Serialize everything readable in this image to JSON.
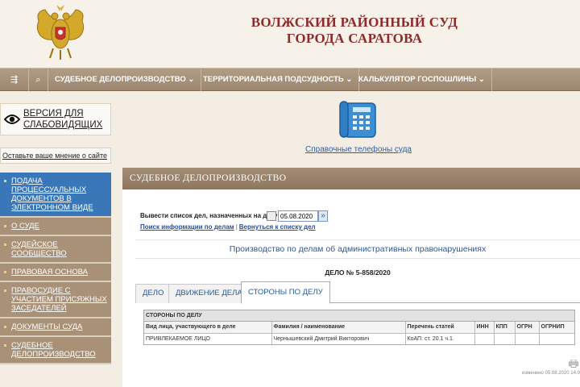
{
  "header": {
    "title_line1": "ВОЛЖСКИЙ РАЙОННЫЙ СУД",
    "title_line2": "ГОРОДА САРАТОВА"
  },
  "nav": {
    "items": [
      {
        "label": "СУДЕБНОЕ ДЕЛОПРОИЗВОДСТВО ⌄"
      },
      {
        "label": "ТЕРРИТОРИАЛЬНАЯ ПОДСУДНОСТЬ ⌄"
      },
      {
        "label": "КАЛЬКУЛЯТОР ГОСПОШЛИНЫ ⌄"
      }
    ],
    "icons": [
      "sitemap-icon",
      "search-icon"
    ]
  },
  "sidebar": {
    "a11y_label": "ВЕРСИЯ ДЛЯ СЛАБОВИДЯЩИХ",
    "feedback_label": "Оставьте ваше мнение о сайте",
    "items": [
      {
        "label": "ПОДАЧА ПРОЦЕССУАЛЬНЫХ ДОКУМЕНТОВ В ЭЛЕКТРОННОМ ВИДЕ",
        "active": true
      },
      {
        "label": "О СУДЕ"
      },
      {
        "label": "СУДЕЙСКОЕ СООБЩЕСТВО"
      },
      {
        "label": "ПРАВОВАЯ ОСНОВА"
      },
      {
        "label": "ПРАВОСУДИЕ С УЧАСТИЕМ ПРИСЯЖНЫХ ЗАСЕДАТЕЛЕЙ"
      },
      {
        "label": "ДОКУМЕНТЫ СУДА"
      },
      {
        "label": "СУДЕБНОЕ ДЕЛОПРОИЗВОДСТВО"
      }
    ]
  },
  "main": {
    "phone_link": "Справочные телефоны суда",
    "section_title": "СУДЕБНОЕ ДЕЛОПРОИЗВОДСТВО",
    "date_label": "Вывести список дел, назначенных на дату",
    "date_value": "05.08.2020",
    "search_link": "Поиск информации по делам",
    "back_link": "Вернуться к списку дел",
    "production_title": "Производство по делам об административных правонарушениях",
    "case_number": "ДЕЛО № 5-858/2020",
    "tabs": [
      {
        "label": "ДЕЛО"
      },
      {
        "label": "ДВИЖЕНИЕ ДЕЛА"
      },
      {
        "label": "СТОРОНЫ ПО ДЕЛУ",
        "active": true
      }
    ],
    "parties": {
      "heading": "СТОРОНЫ ПО ДЕЛУ",
      "columns": [
        "Вид лица, участвующего в деле",
        "Фамилия / наименование",
        "Перечень статей",
        "ИНН",
        "КПП",
        "ОГРН",
        "ОГРНИП"
      ],
      "rows": [
        [
          "ПРИВЛЕКАЕМОЕ ЛИЦО",
          "Чернышевский Дмитрий Викторович",
          "КоАП: ст. 20.1 ч.1",
          "",
          "",
          "",
          ""
        ]
      ]
    },
    "modified": "изменено 05.08.2020 14:0"
  }
}
